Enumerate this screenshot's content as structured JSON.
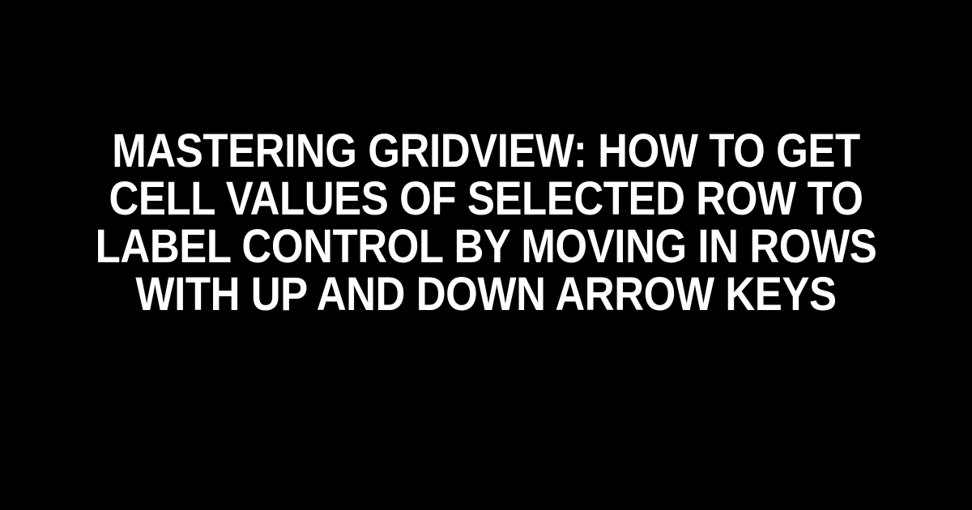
{
  "title": "Mastering GridView: How to Get Cell Values of Selected Row to Label Control by Moving in Rows with Up and Down Arrow Keys"
}
